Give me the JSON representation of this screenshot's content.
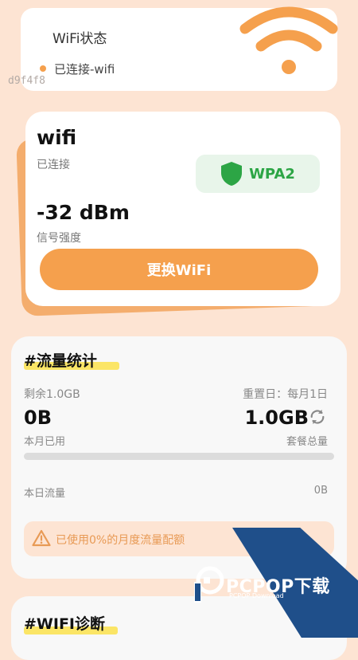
{
  "status_card": {
    "title": "WiFi状态",
    "status_text": "已连接-wifi",
    "dot_color": "#f5a04d",
    "icon": "wifi-icon"
  },
  "code_text": "d9f4f8",
  "wifi_card": {
    "name": "wifi",
    "state": "已连接",
    "security": "WPA2",
    "security_icon": "shield-icon",
    "security_color": "#2ca545",
    "signal_value": "-32 dBm",
    "signal_label": "信号强度",
    "button_label": "更换WiFi",
    "accent": "#f5a04d"
  },
  "traffic_card": {
    "title": "#流量统计",
    "remaining": "剩余1.0GB",
    "reset": "重置日：每月1日",
    "used_value": "0B",
    "used_label": "本月已用",
    "total_value": "1.0GB",
    "total_label": "套餐总量",
    "progress": 0,
    "today_label": "本日流量",
    "today_value": "0B",
    "warning_icon": "warning-icon",
    "warning_text": "已使用0%的月度流量配额"
  },
  "diag_card": {
    "title": "#WIFI诊断"
  },
  "watermark": {
    "logo_text": "PCPOP下载",
    "logo_sub": "PCPOP Download"
  }
}
